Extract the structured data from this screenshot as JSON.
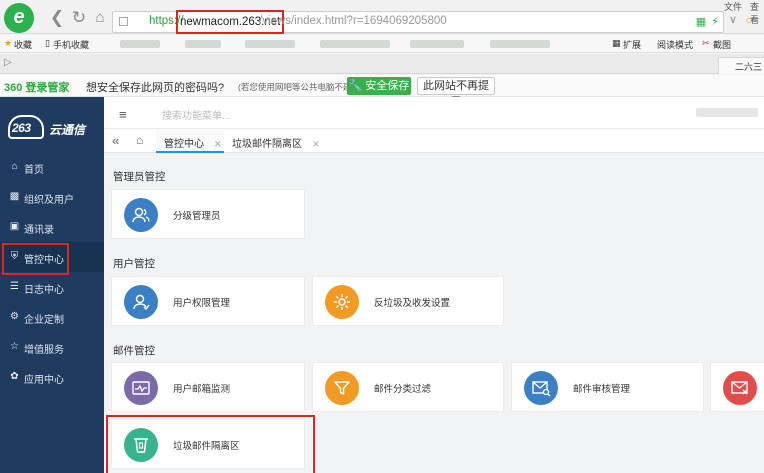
{
  "browser": {
    "url_scheme": "https://",
    "url_host": "newmacom.263.net",
    "url_path": "/views/index.html?r=1694069205800",
    "top_right": [
      "文件",
      "查看"
    ],
    "bookmarks": {
      "favorites": "收藏",
      "mobile_favorites": "手机收藏",
      "extensions": "扩展",
      "reading_mode": "阅读模式",
      "screenshot": "截图"
    },
    "right_tab": "二六三网"
  },
  "password_bar": {
    "brand": "360 登录管家",
    "question": "想安全保存此网页的密码吗?",
    "note": "(若您使用网吧等公共电脑不建议保存)",
    "save_button": "安全保存",
    "never_button": "此网站不再提示"
  },
  "app": {
    "logo_text": "263",
    "logo_suffix": "云通信",
    "search_placeholder": "搜索功能菜单...",
    "sidebar": [
      {
        "label": "首页",
        "icon": "home-icon"
      },
      {
        "label": "组织及用户",
        "icon": "org-icon"
      },
      {
        "label": "通讯录",
        "icon": "contacts-icon"
      },
      {
        "label": "管控中心",
        "icon": "shield-icon"
      },
      {
        "label": "日志中心",
        "icon": "log-icon"
      },
      {
        "label": "企业定制",
        "icon": "gear-icon"
      },
      {
        "label": "增值服务",
        "icon": "star-icon"
      },
      {
        "label": "应用中心",
        "icon": "apps-icon"
      }
    ],
    "tabs": [
      {
        "label": "管控中心"
      },
      {
        "label": "垃圾邮件隔离区"
      }
    ],
    "sections": {
      "admin": {
        "title": "管理员管控",
        "cards": [
          {
            "label": "分级管理员"
          }
        ]
      },
      "user": {
        "title": "用户管控",
        "cards": [
          {
            "label": "用户权限管理"
          },
          {
            "label": "反垃圾及收发设置"
          }
        ]
      },
      "mail": {
        "title": "邮件管控",
        "cards": [
          {
            "label": "用户邮箱监测"
          },
          {
            "label": "邮件分类过滤"
          },
          {
            "label": "邮件审核管理"
          },
          {
            "label": ""
          },
          {
            "label": "垃圾邮件隔离区"
          }
        ]
      }
    }
  },
  "colors": {
    "sidebar_bg": "#1f3b5f",
    "highlight_red": "#d9281f",
    "blue_icon": "#3b7fc4",
    "orange_icon": "#f39a23",
    "purple_icon": "#7b6aa8",
    "teal_icon": "#37b38d",
    "red_icon": "#e44b4b"
  }
}
